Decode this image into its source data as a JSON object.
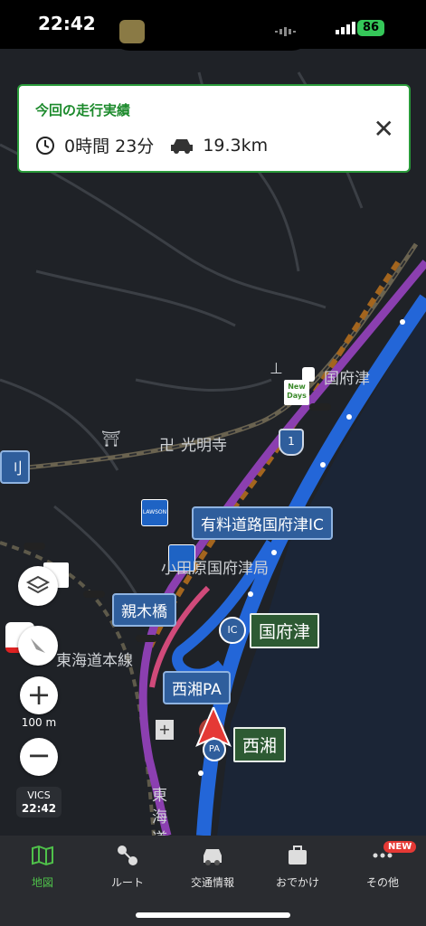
{
  "status_bar": {
    "time": "22:42",
    "battery": "86"
  },
  "drive_panel": {
    "title": "今回の走行実績",
    "duration": "0時間 23分",
    "distance": "19.3km"
  },
  "map_labels": {
    "kozu": "国府津",
    "komyoji": "光明寺",
    "route_1": "1",
    "odawara_post": "小田原国府津局",
    "tokaido_line": "東海道本線",
    "tokaido_vertical": "東海道",
    "kanji_left": "刂",
    "scale": "100 m"
  },
  "callouts": {
    "toll_ic": "有料道路国府津IC",
    "oyagibashi": "親木橋",
    "nishisho_pa": "西湘PA",
    "kozu_ic": "国府津",
    "nishisho": "西湘",
    "ic_badge": "IC",
    "pa_badge": "PA"
  },
  "poi": {
    "newdays_line1": "New",
    "newdays_line2": "Days",
    "lawson": "LAWSON"
  },
  "vics": {
    "label": "VICS",
    "time": "22:42"
  },
  "tabs": [
    {
      "label": "地図",
      "active": true
    },
    {
      "label": "ルート",
      "active": false
    },
    {
      "label": "交通情報",
      "active": false
    },
    {
      "label": "おでかけ",
      "active": false
    },
    {
      "label": "その他",
      "active": false
    }
  ],
  "new_badge": "NEW",
  "colors": {
    "accent_green": "#2a9a3a",
    "route_blue": "#2366d8",
    "route_purple": "#8b3fb0"
  }
}
